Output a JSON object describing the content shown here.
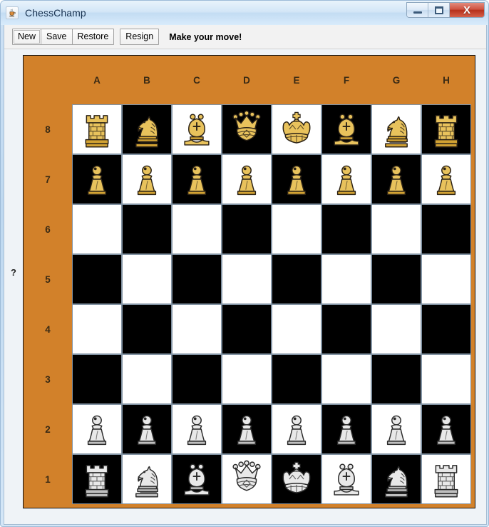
{
  "window": {
    "title": "ChessChamp",
    "app_icon": "java-coffee-cup-icon",
    "controls": {
      "minimize": "minimize-icon",
      "maximize": "maximize-icon",
      "close": "X"
    }
  },
  "toolbar": {
    "new_label": "New",
    "save_label": "Save",
    "restore_label": "Restore",
    "resign_label": "Resign",
    "status": "Make your move!"
  },
  "board": {
    "left_marker": "?",
    "files": [
      "A",
      "B",
      "C",
      "D",
      "E",
      "F",
      "G",
      "H"
    ],
    "ranks": [
      "8",
      "7",
      "6",
      "5",
      "4",
      "3",
      "2",
      "1"
    ],
    "colors": {
      "background": "#d2812a",
      "light_square": "#ffffff",
      "dark_square": "#000000",
      "square_border": "#8293a3",
      "black_piece": "#e0b84f",
      "white_piece": "#d9d9d9"
    },
    "position": [
      [
        "black-rook",
        "black-knight",
        "black-bishop",
        "black-queen",
        "black-king",
        "black-bishop",
        "black-knight",
        "black-rook"
      ],
      [
        "black-pawn",
        "black-pawn",
        "black-pawn",
        "black-pawn",
        "black-pawn",
        "black-pawn",
        "black-pawn",
        "black-pawn"
      ],
      [
        "",
        "",
        "",
        "",
        "",
        "",
        "",
        ""
      ],
      [
        "",
        "",
        "",
        "",
        "",
        "",
        "",
        ""
      ],
      [
        "",
        "",
        "",
        "",
        "",
        "",
        "",
        ""
      ],
      [
        "",
        "",
        "",
        "",
        "",
        "",
        "",
        ""
      ],
      [
        "white-pawn",
        "white-pawn",
        "white-pawn",
        "white-pawn",
        "white-pawn",
        "white-pawn",
        "white-pawn",
        "white-pawn"
      ],
      [
        "white-rook",
        "white-knight",
        "white-bishop",
        "white-queen",
        "white-king",
        "white-bishop",
        "white-knight",
        "white-rook"
      ]
    ]
  }
}
